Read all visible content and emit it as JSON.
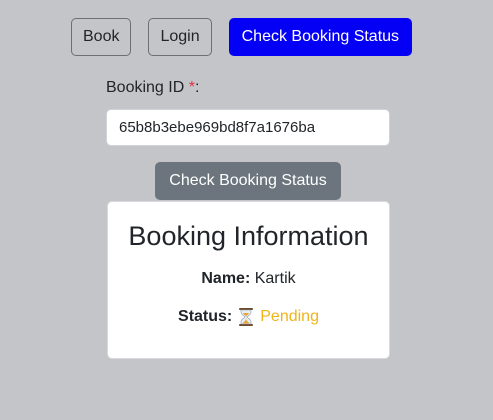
{
  "nav": {
    "book_label": "Book",
    "login_label": "Login",
    "check_status_label": "Check Booking Status",
    "active_color": "#0400f5"
  },
  "form": {
    "booking_id_label": "Booking ID",
    "required_mark": "*",
    "label_suffix": ":",
    "booking_id_value": "65b8b3ebe969bd8f7a1676ba",
    "submit_label": "Check Booking Status"
  },
  "booking_info": {
    "title": "Booking Information",
    "name_label": "Name:",
    "name_value": "Kartik",
    "status_label": "Status:",
    "status_icon": "hourglass-icon",
    "status_value": "Pending",
    "status_color": "#f0b418"
  }
}
